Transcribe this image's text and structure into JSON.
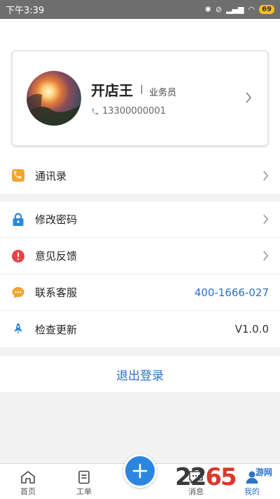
{
  "status_bar": {
    "time": "下午3:39",
    "battery": "69"
  },
  "profile": {
    "name": "开店王",
    "role": "业务员",
    "phone": "13300000001"
  },
  "menu_group_1": [
    {
      "label": "通讯录",
      "icon": "contacts-icon",
      "color": "#f2a531"
    }
  ],
  "menu_group_2": [
    {
      "label": "修改密码",
      "icon": "lock-icon",
      "color": "#2a86e0"
    },
    {
      "label": "意见反馈",
      "icon": "alert-icon",
      "color": "#e64545"
    },
    {
      "label": "联系客服",
      "icon": "chat-icon",
      "color": "#f2a531",
      "value": "400-1666-027"
    },
    {
      "label": "检查更新",
      "icon": "rocket-icon",
      "color": "#2a86e0",
      "value": "V1.0.0"
    }
  ],
  "logout_label": "退出登录",
  "tabs": [
    {
      "label": "首页",
      "icon": "home-icon"
    },
    {
      "label": "工单",
      "icon": "document-icon"
    },
    {
      "label": "消息",
      "icon": "message-icon"
    },
    {
      "label": "我的",
      "icon": "user-icon"
    }
  ],
  "watermark": {
    "text_a": "22",
    "text_b": "65",
    "sub": "游网"
  },
  "colors": {
    "accent": "#2a73c7",
    "fab": "#2b86e0"
  }
}
